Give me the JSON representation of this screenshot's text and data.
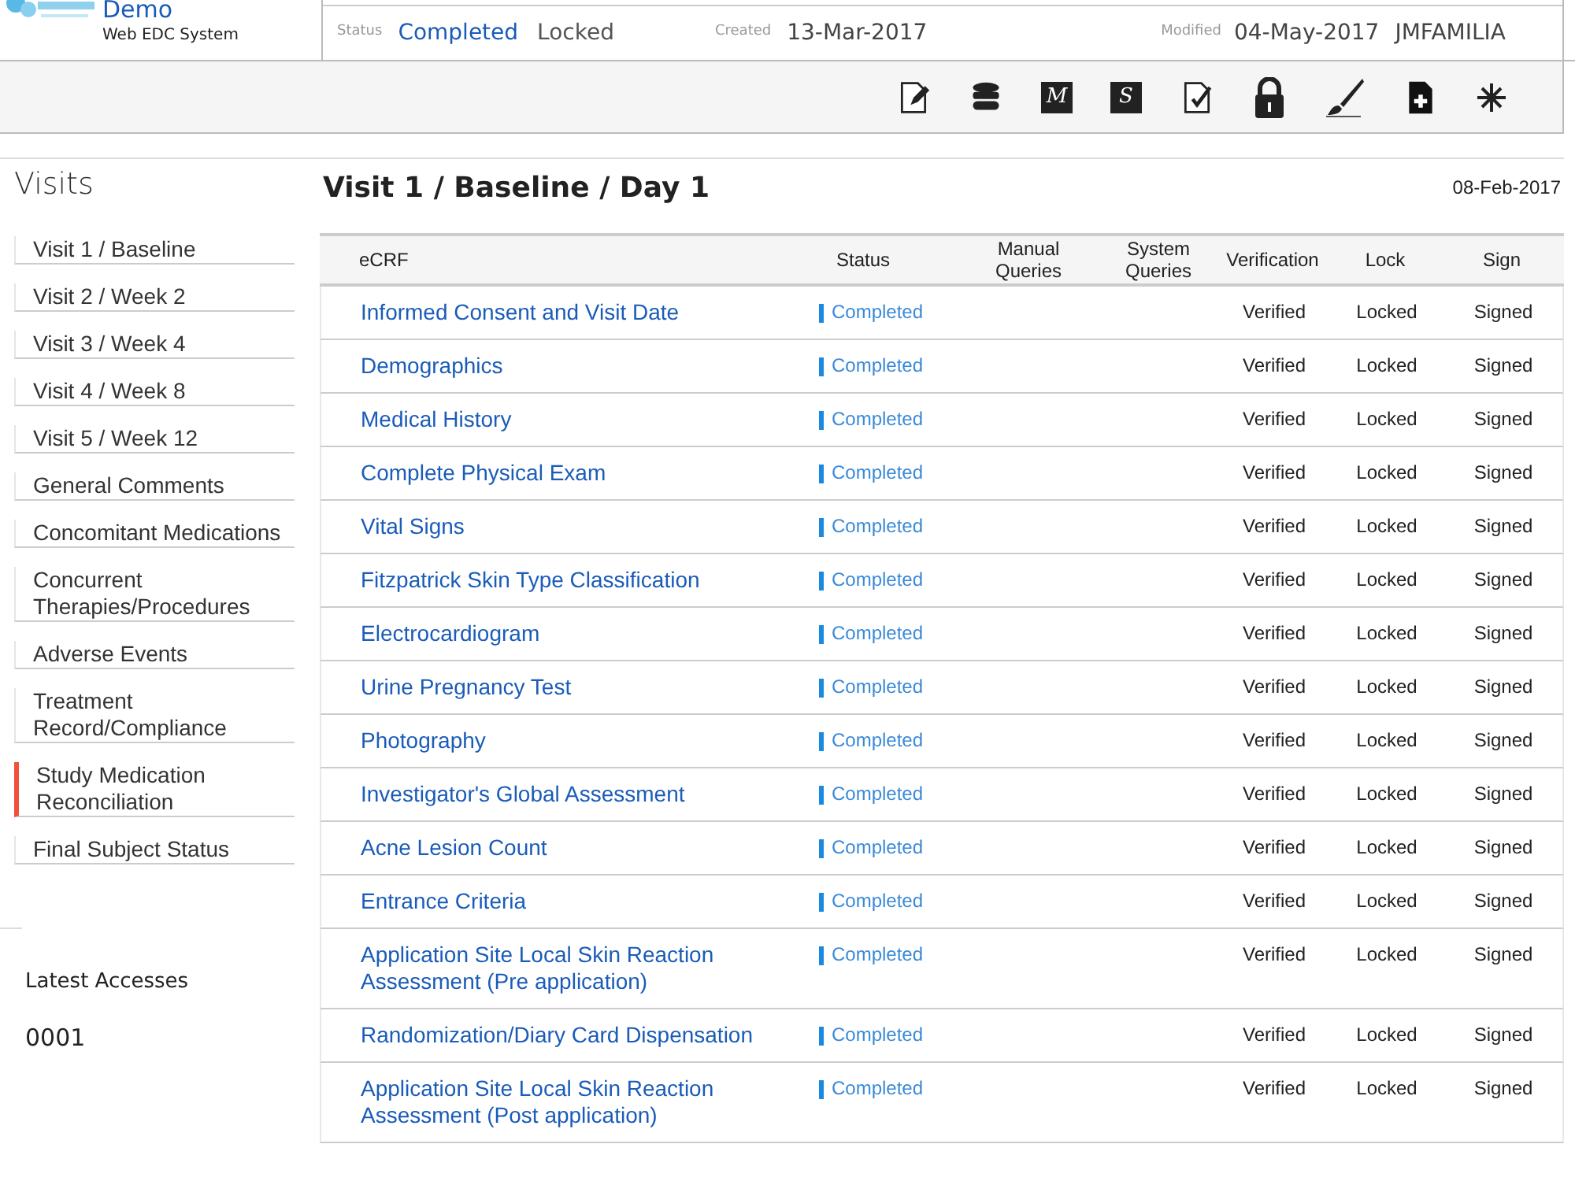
{
  "header": {
    "app_name": "Demo",
    "app_subtitle": "Web EDC System",
    "status_label": "Status",
    "status": "Completed",
    "lock_state": "Locked",
    "created_label": "Created",
    "created": "13-Mar-2017",
    "modified_label": "Modified",
    "modified": "04-May-2017",
    "modified_by": "JMFAMILIA"
  },
  "toolbar": [
    {
      "kind": "edit"
    },
    {
      "kind": "database"
    },
    {
      "kind": "letter",
      "letter": "M"
    },
    {
      "kind": "letter",
      "letter": "S"
    },
    {
      "kind": "check"
    },
    {
      "kind": "lock"
    },
    {
      "kind": "brush"
    },
    {
      "kind": "add"
    },
    {
      "kind": "sparkle"
    }
  ],
  "sidebar": {
    "title": "Visits",
    "items": [
      {
        "label": "Visit 1 / Baseline",
        "selected": false
      },
      {
        "label": "Visit 2 / Week 2",
        "selected": false
      },
      {
        "label": "Visit 3 / Week 4",
        "selected": false
      },
      {
        "label": "Visit 4 / Week 8",
        "selected": false
      },
      {
        "label": "Visit 5 / Week 12",
        "selected": false
      },
      {
        "label": "General Comments",
        "selected": false
      },
      {
        "label": "Concomitant Medications",
        "selected": false
      },
      {
        "label": "Concurrent Therapies/Procedures",
        "selected": false
      },
      {
        "label": "Adverse Events",
        "selected": false
      },
      {
        "label": "Treatment Record/Compliance",
        "selected": false
      },
      {
        "label": "Study Medication Reconciliation",
        "selected": true
      },
      {
        "label": "Final Subject Status",
        "selected": false
      }
    ],
    "latest_title": "Latest Accesses",
    "latest_items": [
      "0001"
    ]
  },
  "main": {
    "title": "Visit 1 / Baseline / Day 1",
    "date": "08-Feb-2017",
    "table": {
      "columns": [
        "eCRF",
        "Status",
        "Manual Queries",
        "System Queries",
        "Verification",
        "Lock",
        "Sign"
      ],
      "rows": [
        {
          "ecrf": "Informed Consent and Visit Date",
          "status": "Completed",
          "verification": "Verified",
          "lock": "Locked",
          "sign": "Signed"
        },
        {
          "ecrf": "Demographics",
          "status": "Completed",
          "verification": "Verified",
          "lock": "Locked",
          "sign": "Signed"
        },
        {
          "ecrf": "Medical History",
          "status": "Completed",
          "verification": "Verified",
          "lock": "Locked",
          "sign": "Signed"
        },
        {
          "ecrf": "Complete Physical Exam",
          "status": "Completed",
          "verification": "Verified",
          "lock": "Locked",
          "sign": "Signed"
        },
        {
          "ecrf": "Vital Signs",
          "status": "Completed",
          "verification": "Verified",
          "lock": "Locked",
          "sign": "Signed"
        },
        {
          "ecrf": "Fitzpatrick Skin Type Classification",
          "status": "Completed",
          "verification": "Verified",
          "lock": "Locked",
          "sign": "Signed"
        },
        {
          "ecrf": "Electrocardiogram",
          "status": "Completed",
          "verification": "Verified",
          "lock": "Locked",
          "sign": "Signed"
        },
        {
          "ecrf": "Urine Pregnancy Test",
          "status": "Completed",
          "verification": "Verified",
          "lock": "Locked",
          "sign": "Signed"
        },
        {
          "ecrf": "Photography",
          "status": "Completed",
          "verification": "Verified",
          "lock": "Locked",
          "sign": "Signed"
        },
        {
          "ecrf": "Investigator's Global Assessment",
          "status": "Completed",
          "verification": "Verified",
          "lock": "Locked",
          "sign": "Signed"
        },
        {
          "ecrf": "Acne Lesion Count",
          "status": "Completed",
          "verification": "Verified",
          "lock": "Locked",
          "sign": "Signed"
        },
        {
          "ecrf": "Entrance Criteria",
          "status": "Completed",
          "verification": "Verified",
          "lock": "Locked",
          "sign": "Signed"
        },
        {
          "ecrf": "Application Site Local Skin Reaction Assessment (Pre application)",
          "status": "Completed",
          "verification": "Verified",
          "lock": "Locked",
          "sign": "Signed"
        },
        {
          "ecrf": "Randomization/Diary Card Dispensation",
          "status": "Completed",
          "verification": "Verified",
          "lock": "Locked",
          "sign": "Signed"
        },
        {
          "ecrf": "Application Site Local Skin Reaction Assessment (Post application)",
          "status": "Completed",
          "verification": "Verified",
          "lock": "Locked",
          "sign": "Signed"
        }
      ]
    }
  }
}
